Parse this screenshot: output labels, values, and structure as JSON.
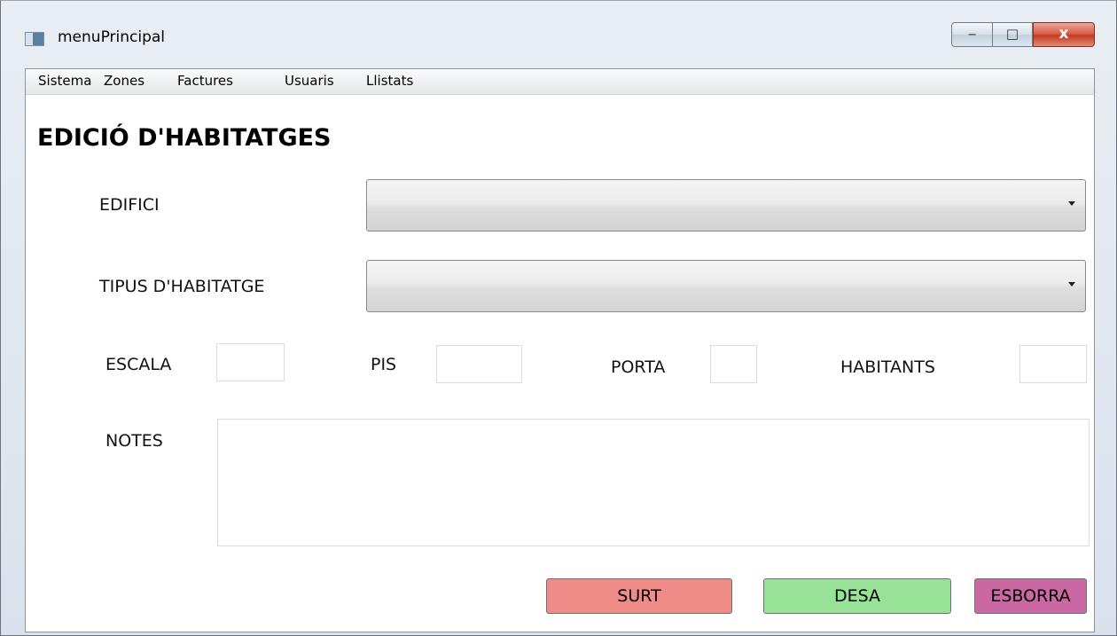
{
  "window": {
    "title": "menuPrincipal",
    "controls": {
      "minimize": "‒",
      "maximize": "□",
      "close": "x"
    }
  },
  "menu": {
    "items": [
      "Sistema",
      "Zones",
      "Factures",
      "Usuaris",
      "Llistats"
    ]
  },
  "form": {
    "heading": "EDICIÓ D'HABITATGES",
    "labels": {
      "edifici": "EDIFICI",
      "tipus": "TIPUS D'HABITATGE",
      "escala": "ESCALA",
      "pis": "PIS",
      "porta": "PORTA",
      "habitants": "HABITANTS",
      "notes": "NOTES"
    },
    "values": {
      "edifici": "",
      "tipus": "",
      "escala": "",
      "pis": "",
      "porta": "",
      "habitants": "",
      "notes": ""
    }
  },
  "buttons": {
    "surt": "SURT",
    "desa": "DESA",
    "esborra": "ESBORRA"
  },
  "colors": {
    "surt": "#f08c88",
    "desa": "#98e298",
    "esborra": "#c968a3"
  }
}
